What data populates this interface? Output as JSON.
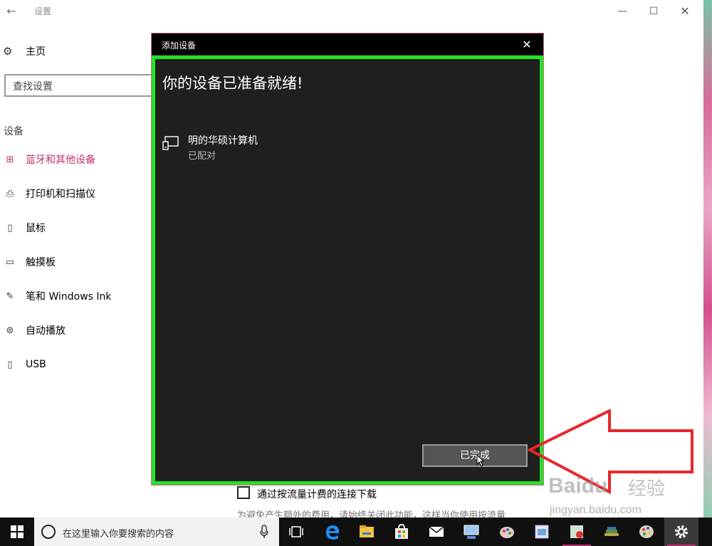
{
  "window": {
    "title": "设置",
    "back_glyph": "←",
    "minimize_glyph": "—",
    "maximize_glyph": "☐",
    "close_glyph": "✕"
  },
  "sidebar": {
    "home_label": "主页",
    "search_placeholder": "查找设置",
    "section_title": "设备",
    "items": [
      {
        "label": "蓝牙和其他设备",
        "icon": "bluetooth-devices-icon",
        "glyph": "⊞",
        "active": true
      },
      {
        "label": "打印机和扫描仪",
        "icon": "printer-icon",
        "glyph": "⎙",
        "active": false
      },
      {
        "label": "鼠标",
        "icon": "mouse-icon",
        "glyph": "▯",
        "active": false
      },
      {
        "label": "触摸板",
        "icon": "touchpad-icon",
        "glyph": "▭",
        "active": false
      },
      {
        "label": "笔和 Windows Ink",
        "icon": "pen-icon",
        "glyph": "✎",
        "active": false
      },
      {
        "label": "自动播放",
        "icon": "autoplay-icon",
        "glyph": "⊚",
        "active": false
      },
      {
        "label": "USB",
        "icon": "usb-icon",
        "glyph": "▯",
        "active": false
      }
    ]
  },
  "main": {
    "metered_label": "通过按流量计费的连接下载",
    "metered_desc": "为避免产生额外的费用，请始终关闭此功能，这样当你使用按流量"
  },
  "dialog": {
    "title": "添加设备",
    "close_glyph": "✕",
    "heading": "你的设备已准备就绪!",
    "device_name": "明的华硕计算机",
    "device_status": "已配对",
    "done_label": "已完成"
  },
  "annotation": {
    "highlight_color": "#22e22a",
    "arrow_color": "#e8262b"
  },
  "watermark": {
    "brand": "Baidu",
    "cn": "经验",
    "url": "jingyan.baidu.com"
  },
  "taskbar": {
    "search_placeholder": "在这里输入你要搜索的内容",
    "apps": [
      "task-view-icon",
      "edge-icon",
      "file-explorer-icon",
      "store-icon",
      "mail-icon",
      "network-app-icon",
      "paint-icon",
      "photo-app-icon",
      "media-app-icon",
      "books-app-icon",
      "palette-app-icon",
      "settings-app-icon"
    ]
  },
  "accent_color": "#c0306f"
}
